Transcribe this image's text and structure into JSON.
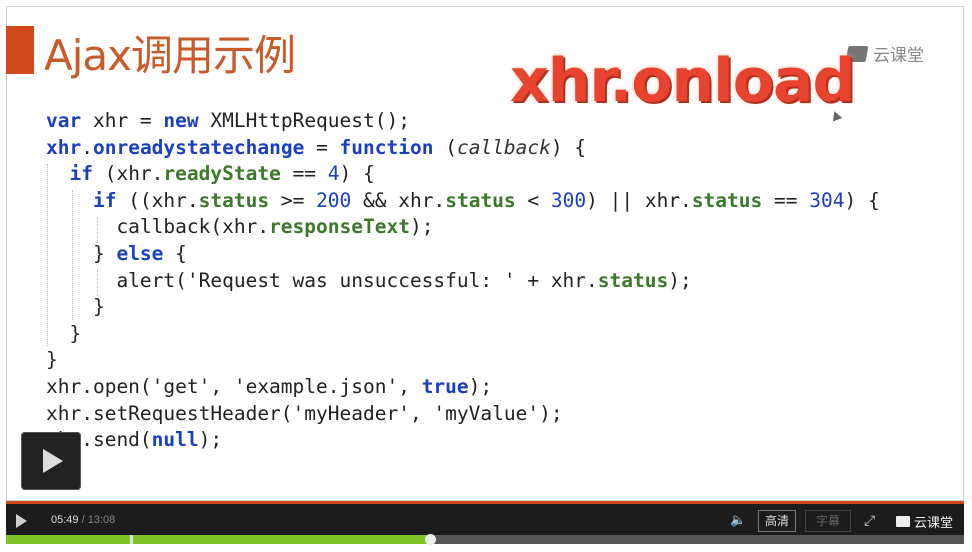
{
  "slide": {
    "title": "Ajax调用示例",
    "logo_text": "云课堂",
    "overlay_text": "xhr.onload"
  },
  "code_lines": [
    [
      {
        "t": "var",
        "c": "kw"
      },
      {
        "t": " xhr = "
      },
      {
        "t": "new",
        "c": "kw"
      },
      {
        "t": " XMLHttpRequest();"
      }
    ],
    [
      {
        "t": "xhr",
        "c": "kw"
      },
      {
        "t": "."
      },
      {
        "t": "onreadystatechange",
        "c": "kw"
      },
      {
        "t": " = "
      },
      {
        "t": "function",
        "c": "kw"
      },
      {
        "t": " ("
      },
      {
        "t": "callback",
        "c": "cb"
      },
      {
        "t": ") {"
      }
    ],
    [
      {
        "t": "  "
      },
      {
        "t": "if",
        "c": "kw"
      },
      {
        "t": " (xhr."
      },
      {
        "t": "readyState",
        "c": "prop"
      },
      {
        "t": " == "
      },
      {
        "t": "4",
        "c": "num"
      },
      {
        "t": ") {"
      }
    ],
    [
      {
        "t": "    "
      },
      {
        "t": "if",
        "c": "kw"
      },
      {
        "t": " ((xhr."
      },
      {
        "t": "status",
        "c": "prop"
      },
      {
        "t": " >= "
      },
      {
        "t": "200",
        "c": "num"
      },
      {
        "t": " && xhr."
      },
      {
        "t": "status",
        "c": "prop"
      },
      {
        "t": " < "
      },
      {
        "t": "300",
        "c": "num"
      },
      {
        "t": ") || xhr."
      },
      {
        "t": "status",
        "c": "prop"
      },
      {
        "t": " == "
      },
      {
        "t": "304",
        "c": "num"
      },
      {
        "t": ") {"
      }
    ],
    [
      {
        "t": "      callback(xhr."
      },
      {
        "t": "responseText",
        "c": "prop"
      },
      {
        "t": ");"
      }
    ],
    [
      {
        "t": "    } "
      },
      {
        "t": "else",
        "c": "kw"
      },
      {
        "t": " {"
      }
    ],
    [
      {
        "t": "      alert('Request was unsuccessful: ' + xhr."
      },
      {
        "t": "status",
        "c": "prop"
      },
      {
        "t": ");"
      }
    ],
    [
      {
        "t": "    }"
      }
    ],
    [
      {
        "t": "  }"
      }
    ],
    [
      {
        "t": "}"
      }
    ],
    [
      {
        "t": "xhr.open('get', 'example.json', "
      },
      {
        "t": "true",
        "c": "kw"
      },
      {
        "t": ");"
      }
    ],
    [
      {
        "t": "xhr.setRequestHeader('myHeader', 'myValue');"
      }
    ],
    [
      {
        "t": "xhr.send("
      },
      {
        "t": "null",
        "c": "kw"
      },
      {
        "t": ");"
      }
    ]
  ],
  "player": {
    "current_time": "05:49",
    "separator": " / ",
    "total_time": "13:08",
    "hq_label": "高清",
    "subtitle_label": "字幕",
    "logo_text": "云课堂",
    "progress_fraction": 0.443,
    "icons": {
      "play": "play-icon",
      "volume": "volume-icon",
      "fullscreen": "fullscreen-icon",
      "big_play": "big-play-icon"
    }
  }
}
